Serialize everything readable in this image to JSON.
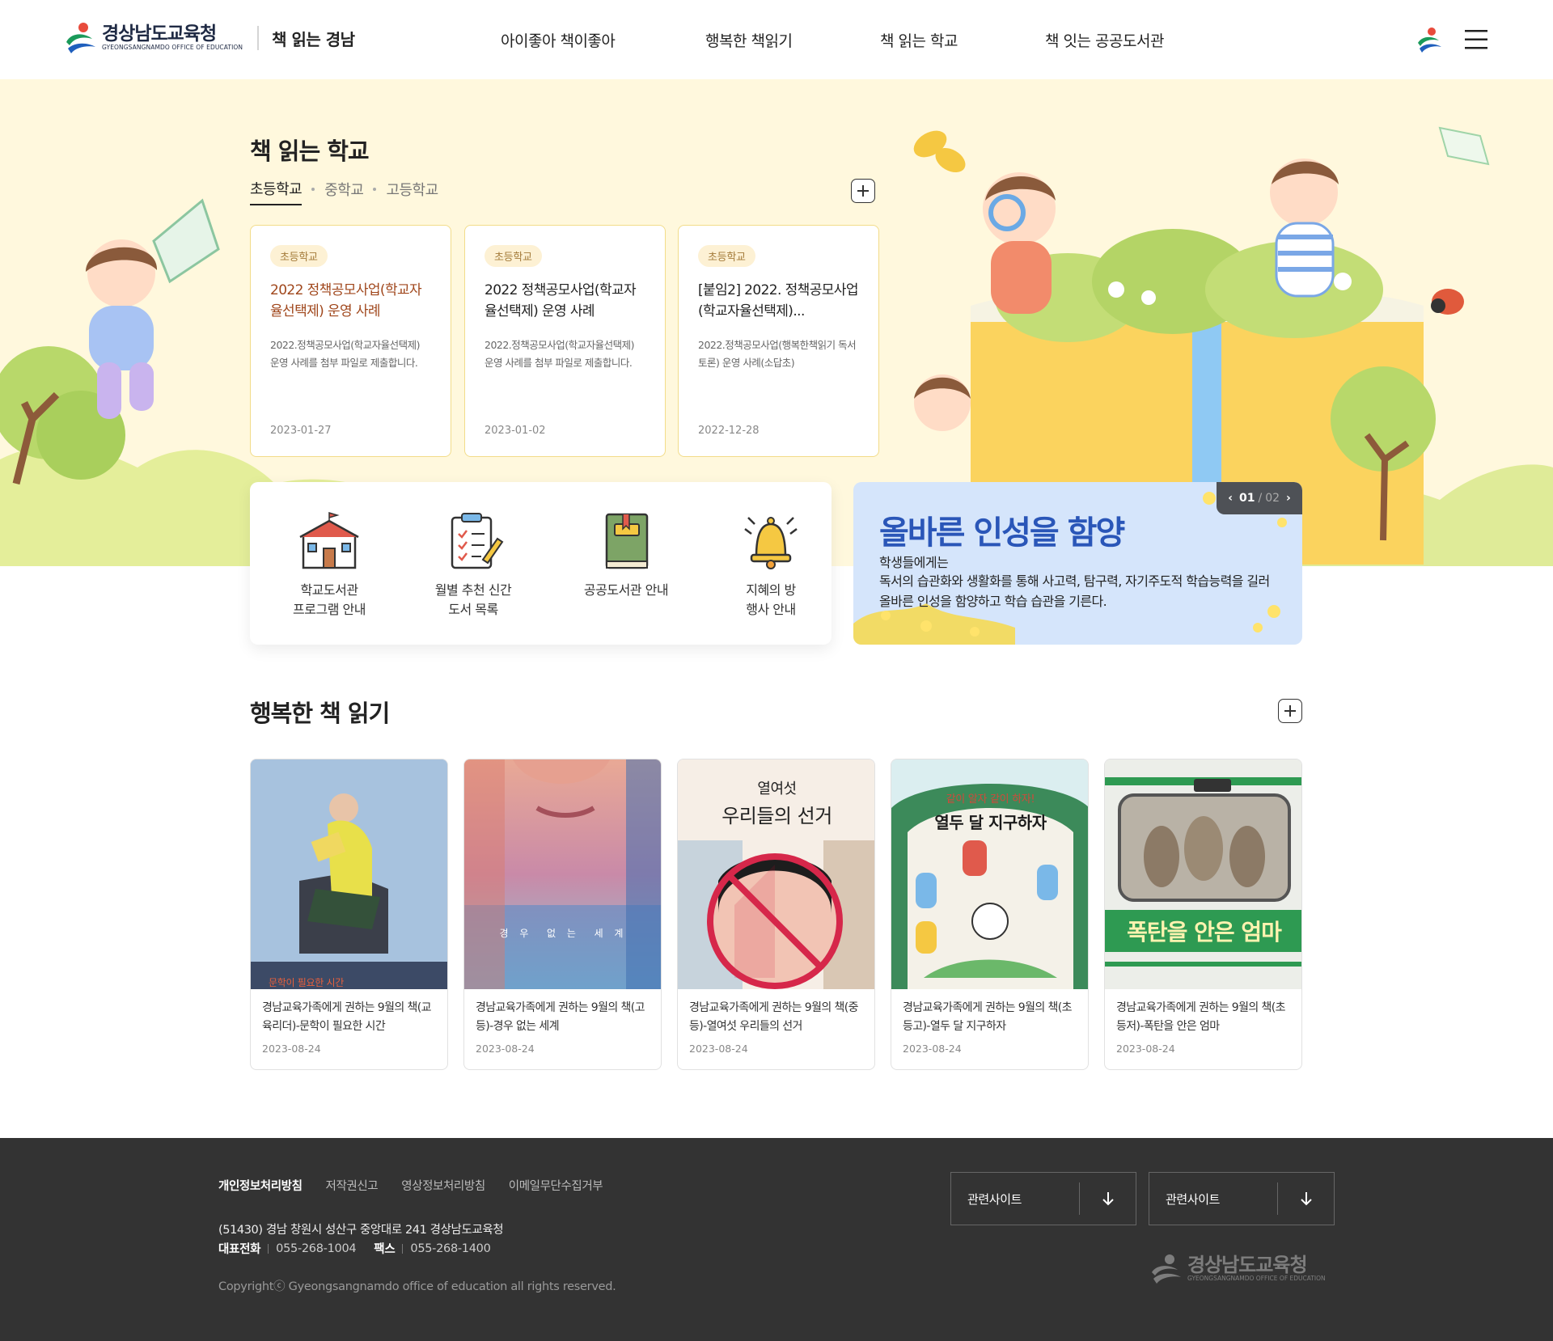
{
  "header": {
    "logo_ko": "경상남도교육청",
    "logo_en": "GYEONGSANGNAMDO OFFICE OF EDUCATION",
    "site_name": "책 읽는 경남",
    "nav": [
      "아이좋아 책이좋아",
      "행복한 책읽기",
      "책 읽는 학교",
      "책 잇는 공공도서관"
    ]
  },
  "school": {
    "title": "책 읽는 학교",
    "tabs": [
      "초등학교",
      "중학교",
      "고등학교"
    ],
    "active_tab": "초등학교",
    "posts": [
      {
        "badge": "초등학교",
        "title": "2022 정책공모사업(학교자율선택제) 운영 사례",
        "desc": "2022.정책공모사업(학교자율선택제) 운영 사례를 첨부 파일로 제출합니다.",
        "date": "2023-01-27"
      },
      {
        "badge": "초등학교",
        "title": "2022 정책공모사업(학교자율선택제) 운영 사례",
        "desc": "2022.정책공모사업(학교자율선택제) 운영 사례를 첨부 파일로 제출합니다.",
        "date": "2023-01-02"
      },
      {
        "badge": "초등학교",
        "title": "[붙임2] 2022. 정책공모사업(학교자율선택제)...",
        "desc": "2022.정책공모사업(행복한책읽기 독서토론) 운영 사례(소답초)",
        "date": "2022-12-28"
      }
    ]
  },
  "quick_menu": [
    {
      "label": "학교도서관\n프로그램 안내",
      "icon": "school-icon"
    },
    {
      "label": "월별 추천 신간\n도서 목록",
      "icon": "clipboard-icon"
    },
    {
      "label": "공공도서관 안내",
      "icon": "book-icon"
    },
    {
      "label": "지혜의 방\n행사 안내",
      "icon": "bell-icon"
    }
  ],
  "promo": {
    "headline": "올바른 인성을 함양",
    "sub": "학생들에게는",
    "body": "독서의 습관화와 생활화를 통해 사고력, 탐구력, 자기주도적 학습능력을 길러 올바른 인성을 함양하고 학습 습관을 기른다.",
    "page_current": "01",
    "page_sep": "/",
    "page_total": "02"
  },
  "happy": {
    "title": "행복한 책 읽기",
    "books": [
      {
        "title": "경남교육가족에게 권하는 9월의 책(교육리더)-문학이 필요한 시간",
        "date": "2023-08-24",
        "cover_text": "문학이 필요한 시간"
      },
      {
        "title": "경남교육가족에게 권하는 9월의 책(고등)-경우 없는 세계",
        "date": "2023-08-24",
        "cover_text": "경 우  없 는  세 계"
      },
      {
        "title": "경남교육가족에게 권하는 9월의 책(중등)-열여섯 우리들의 선거",
        "date": "2023-08-24",
        "cover_text_1": "열여섯",
        "cover_text_2": "우리들의 선거"
      },
      {
        "title": "경남교육가족에게 권하는 9월의 책(초등고)-열두 달 지구하자",
        "date": "2023-08-24",
        "cover_text_1": "같이 알자 같이 하자!",
        "cover_text_2": "열두 달 지구하자"
      },
      {
        "title": "경남교육가족에게 권하는 9월의 책(초등저)-폭탄을 안은 엄마",
        "date": "2023-08-24",
        "cover_text": "폭탄을 안은 엄마"
      }
    ]
  },
  "footer": {
    "links": [
      "개인정보처리방침",
      "저작권신고",
      "영상정보처리방침",
      "이메일무단수집거부"
    ],
    "address": "(51430) 경남 창원시 성산구 중앙대로 241 경상남도교육청",
    "tel_label": "대표전화",
    "tel": "055-268-1004",
    "fax_label": "팩스",
    "fax": "055-268-1400",
    "copyright": "Copyrightⓒ Gyeongsangnamdo office of education all rights reserved.",
    "select1": "관련사이트",
    "select2": "관련사이트",
    "logo_ko": "경상남도교육청",
    "logo_en": "GYEONGSANGNAMDO OFFICE OF EDUCATION"
  }
}
